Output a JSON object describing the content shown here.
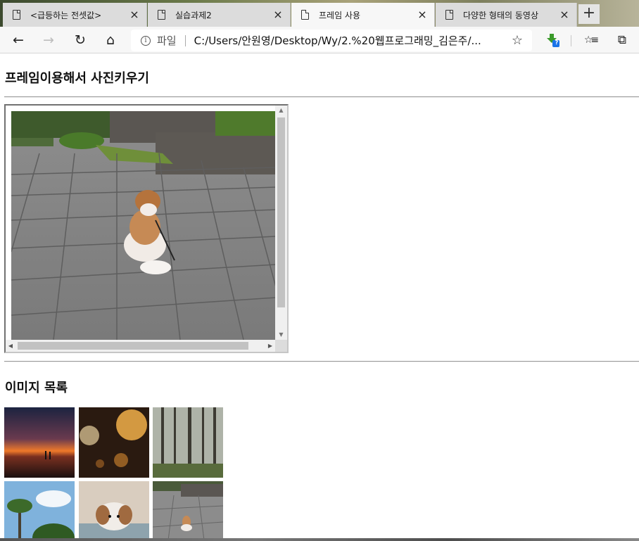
{
  "browser": {
    "tabs": [
      {
        "title": "<급등하는 전셋값>",
        "active": false
      },
      {
        "title": "실습과제2",
        "active": false
      },
      {
        "title": "프레임 사용",
        "active": true
      },
      {
        "title": "다양한 형태의 동영상",
        "active": false
      }
    ],
    "new_tab_symbol": "+",
    "toolbar": {
      "back_icon": "←",
      "forward_icon": "→",
      "refresh_icon": "↻",
      "home_icon": "⌂",
      "info_icon": "i",
      "scheme_label": "파일",
      "url": "C:/Users/안원영/Desktop/Wy/2.%20웹프로그래밍_김은주/...",
      "favorite_icon": "☆",
      "extension_badge": "?",
      "favorites_icon": "☆≡",
      "collections_icon": "⧉"
    }
  },
  "page": {
    "frame_heading": "프레임이용해서 사진키우기",
    "gallery_heading": "이미지 목록",
    "gallery": [
      {
        "name": "sunset-sea"
      },
      {
        "name": "rain-bokeh"
      },
      {
        "name": "pine-forest"
      },
      {
        "name": "palm-trees-sky"
      },
      {
        "name": "puppy-blanket"
      },
      {
        "name": "puppy-pavement"
      }
    ]
  },
  "colors": {
    "tab_active": "#f7f7f7",
    "tab_inactive": "#dcdcdc",
    "toolbar_bg": "#f7f7f7",
    "hr": "#9a9a9a",
    "scroll_thumb": "#c2c2c2",
    "badge_blue": "#1a73e8"
  }
}
